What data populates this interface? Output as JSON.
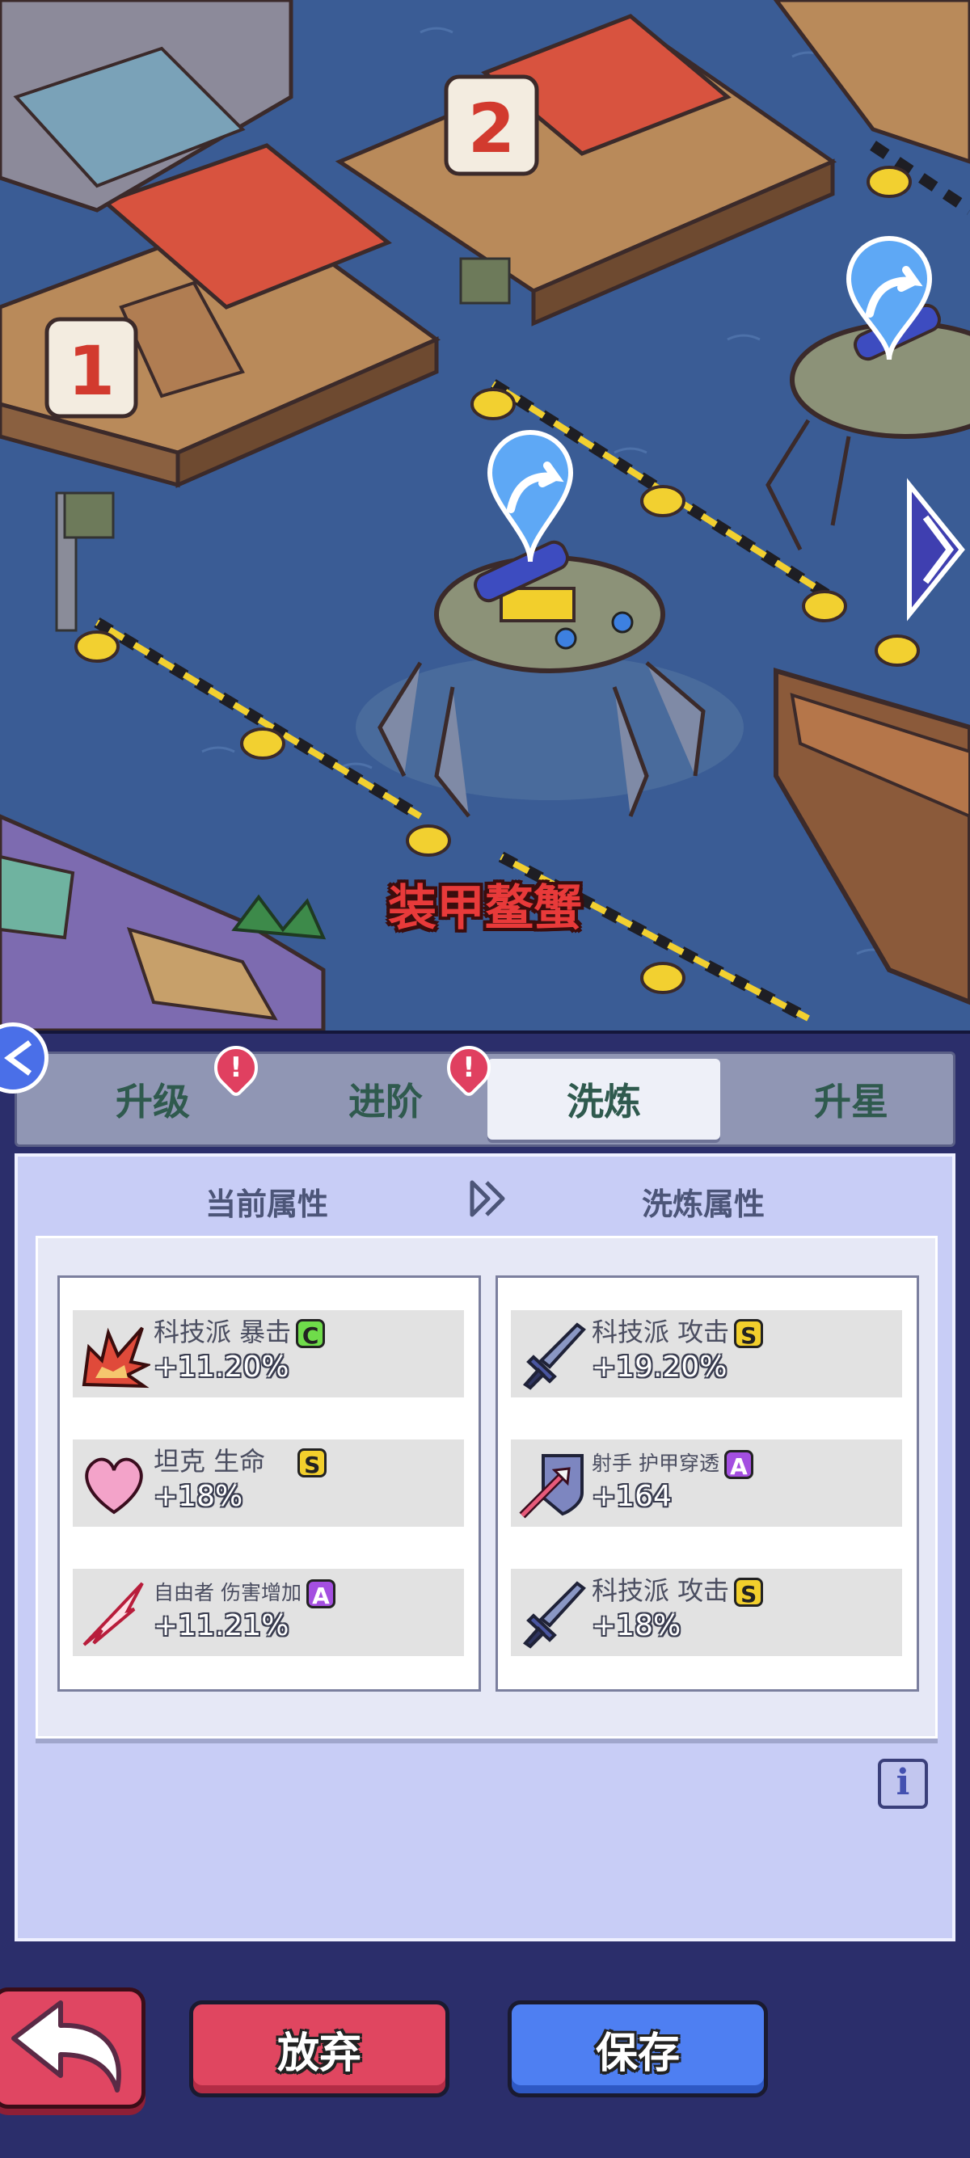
{
  "scene": {
    "unit_name": "装甲鳌蟹",
    "dock_numbers": [
      "1",
      "2"
    ]
  },
  "tabs": [
    {
      "label": "升级",
      "alert": true,
      "active": false
    },
    {
      "label": "进阶",
      "alert": true,
      "active": false
    },
    {
      "label": "洗炼",
      "alert": false,
      "active": true
    },
    {
      "label": "升星",
      "alert": false,
      "active": false
    }
  ],
  "alert_mark": "!",
  "headers": {
    "current": "当前属性",
    "reroll": "洗炼属性"
  },
  "current_stats": [
    {
      "label": "科技派 暴击",
      "grade": "C",
      "value": "+11.20%",
      "icon": "crit-burst-icon"
    },
    {
      "label": "坦克 生命",
      "grade": "S",
      "value": "+18%",
      "icon": "heart-icon"
    },
    {
      "label": "自由者 伤害增加",
      "grade": "A",
      "value": "+11.21%",
      "icon": "slash-icon"
    }
  ],
  "reroll_stats": [
    {
      "label": "科技派 攻击",
      "grade": "S",
      "value": "+19.20%",
      "icon": "sword-icon"
    },
    {
      "label": "射手 护甲穿透",
      "grade": "A",
      "value": "+164",
      "icon": "armor-pierce-icon"
    },
    {
      "label": "科技派 攻击",
      "grade": "S",
      "value": "+18%",
      "icon": "sword-icon"
    }
  ],
  "grade_colors": {
    "S": "#f2cf2c",
    "A": "#a44fe0",
    "C": "#6fdc4a"
  },
  "info_label": "i",
  "buttons": {
    "abandon": "放弃",
    "save": "保存"
  }
}
